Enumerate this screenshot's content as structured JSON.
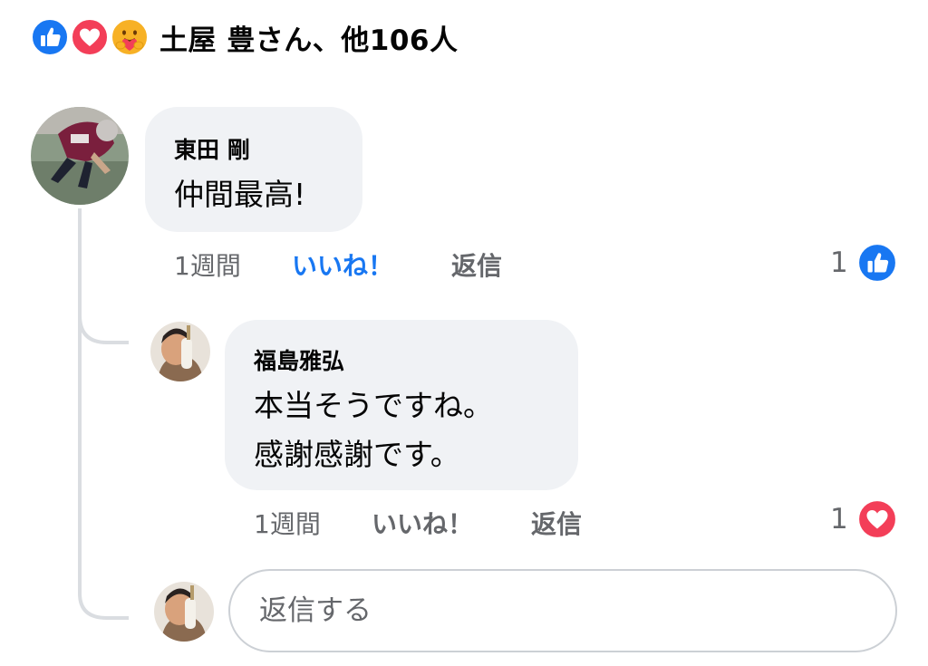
{
  "reactions": {
    "icons": [
      "like-icon",
      "love-icon",
      "care-icon"
    ],
    "summary": "土屋 豊さん、他106人"
  },
  "comments": [
    {
      "author": "東田 剛",
      "text_lines": [
        "仲間最高!"
      ],
      "time": "1週間",
      "like_label": "いいね！",
      "reply_label": "返信",
      "reaction_count": "1",
      "reaction_icon": "like-icon"
    },
    {
      "author": "福島雅弘",
      "text_lines": [
        "本当そうですね。",
        "感謝感謝です。"
      ],
      "time": "1週間",
      "like_label": "いいね！",
      "reply_label": "返信",
      "reaction_count": "1",
      "reaction_icon": "love-icon"
    }
  ],
  "reply_input": {
    "placeholder": "返信する"
  },
  "colors": {
    "like_blue": "#1877f2",
    "love_red": "#f33e58",
    "bubble_bg": "#f0f2f5",
    "secondary_text": "#65676b"
  }
}
